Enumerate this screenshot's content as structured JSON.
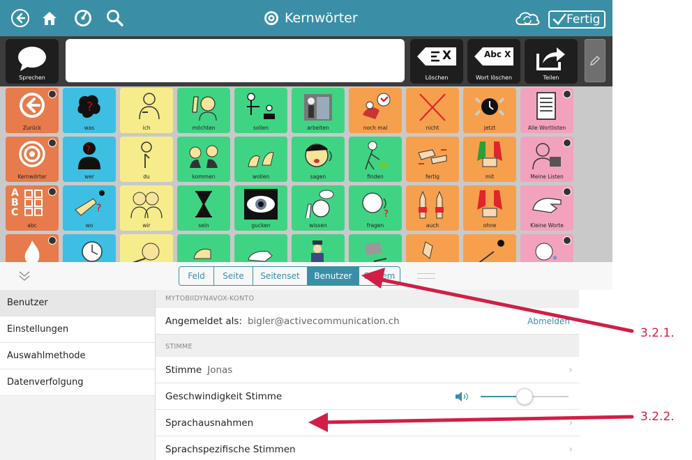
{
  "topbar": {
    "title": "Kernwörter",
    "done_label": "Fertig"
  },
  "toolbar": {
    "speak_label": "Sprechen",
    "clear_label": "Löschen",
    "delete_word_label": "Wort löschen",
    "share_label": "Teilen",
    "clear_icon_text": "X",
    "delete_word_icon_text": "Abc X"
  },
  "grid": {
    "row1": [
      "Zurück",
      "was",
      "ich",
      "möchten",
      "sollen",
      "arbeiten",
      "noch mal",
      "nicht",
      "jetzt",
      "Alle Wortlisten"
    ],
    "row2": [
      "Kernwörter",
      "wer",
      "du",
      "kommen",
      "wollen",
      "sagen",
      "finden",
      "fertig",
      "mit",
      "Meine Listen"
    ],
    "row3": [
      "abc",
      "wo",
      "wir",
      "sein",
      "gucken",
      "wissen",
      "fragen",
      "auch",
      "ohne",
      "Kleine Worte"
    ],
    "abc_letters": "A B C"
  },
  "tabs": [
    "Feld",
    "Seite",
    "Seitenset",
    "Benutzer",
    "System"
  ],
  "active_tab": "Benutzer",
  "sidebar": {
    "items": [
      "Benutzer",
      "Einstellungen",
      "Auswahlmethode",
      "Datenverfolgung"
    ]
  },
  "content": {
    "account_section": "MYTOBIIDYNAVOX-KONTO",
    "logged_in_label": "Angemeldet als:",
    "logged_in_email": "bigler@activecommunication.ch",
    "logout_label": "Abmelden",
    "voice_section": "STIMME",
    "voice_label": "Stimme",
    "voice_value": "Jonas",
    "speed_label": "Geschwindigkeit Stimme",
    "speed_value": 0.5,
    "exceptions_label": "Sprachausnahmen",
    "language_voices_label": "Sprachspezifische Stimmen"
  },
  "annotations": {
    "a1": "3.2.1.",
    "a2": "3.2.2."
  },
  "colors": {
    "accent": "#3a8fa6",
    "arrow": "#d21e45"
  }
}
